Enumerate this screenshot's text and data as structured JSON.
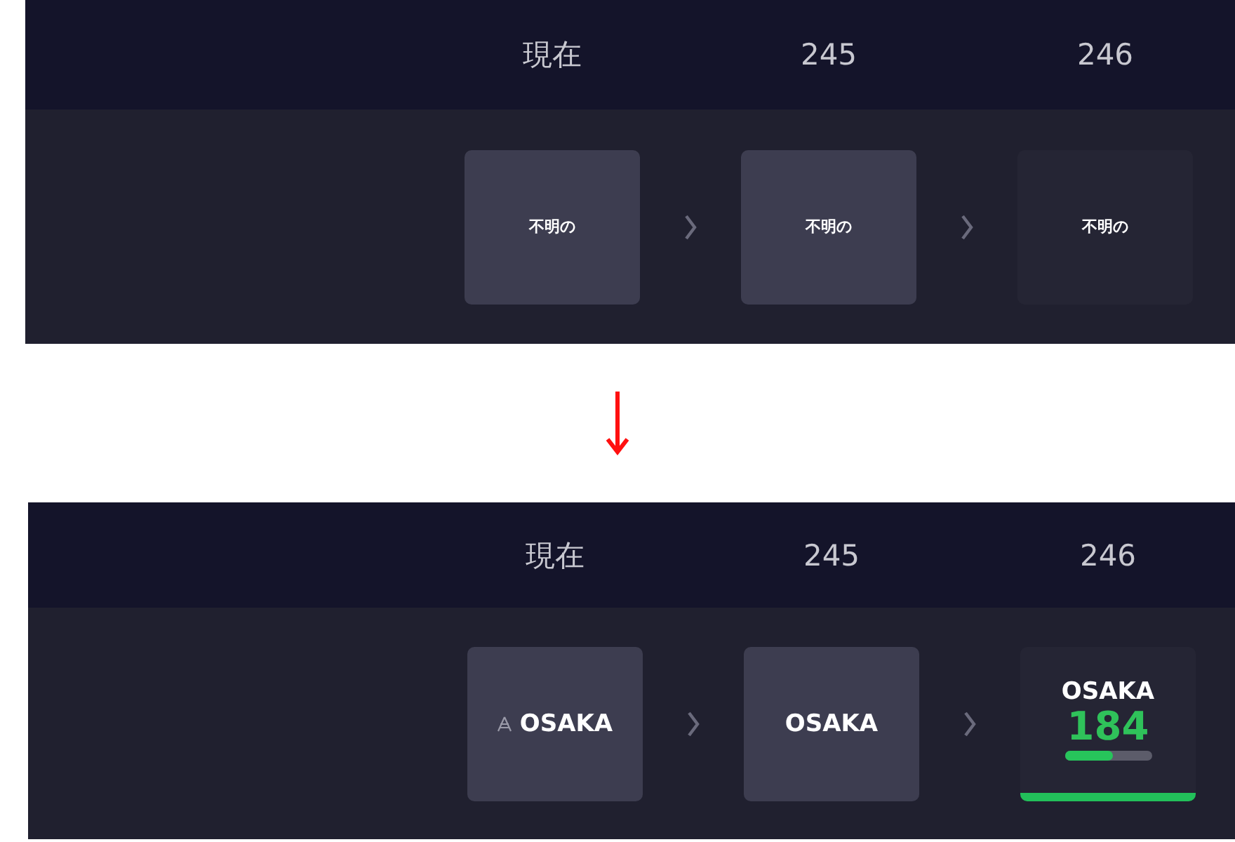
{
  "panels": [
    {
      "columns": [
        {
          "label": "現在",
          "card": {
            "kind": "text",
            "name": "不明の",
            "dim": false,
            "selected": false
          }
        },
        {
          "label": "245",
          "card": {
            "kind": "text",
            "name": "不明の",
            "dim": false,
            "selected": false
          }
        },
        {
          "label": "246",
          "card": {
            "kind": "text",
            "name": "不明の",
            "dim": true,
            "selected": false
          }
        }
      ]
    },
    {
      "columns": [
        {
          "label": "現在",
          "card": {
            "kind": "emblem",
            "name": "OSAKA",
            "dim": false,
            "selected": false
          }
        },
        {
          "label": "245",
          "card": {
            "kind": "text",
            "name": "OSAKA",
            "dim": false,
            "selected": false
          }
        },
        {
          "label": "246",
          "card": {
            "kind": "score",
            "name": "OSAKA",
            "score": "184",
            "level": 0.55,
            "dim": true,
            "selected": true
          }
        }
      ]
    }
  ]
}
